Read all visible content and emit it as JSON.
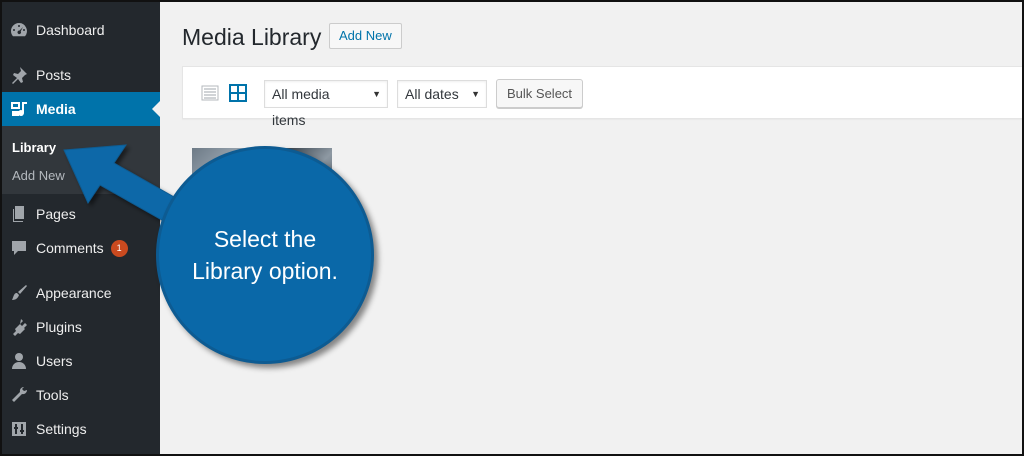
{
  "sidebar": {
    "items": [
      {
        "label": "Dashboard",
        "icon": "dashboard-icon"
      },
      {
        "label": "Posts",
        "icon": "pushpin-icon"
      },
      {
        "label": "Media",
        "icon": "media-icon"
      },
      {
        "label": "Pages",
        "icon": "pages-icon"
      },
      {
        "label": "Comments",
        "icon": "comment-icon",
        "badge": "1"
      },
      {
        "label": "Appearance",
        "icon": "paintbrush-icon"
      },
      {
        "label": "Plugins",
        "icon": "plugin-icon"
      },
      {
        "label": "Users",
        "icon": "user-icon"
      },
      {
        "label": "Tools",
        "icon": "wrench-icon"
      },
      {
        "label": "Settings",
        "icon": "settings-icon"
      }
    ],
    "submenu": [
      "Library",
      "Add New"
    ],
    "active": "Media",
    "active_color": "#0073aa"
  },
  "main": {
    "title": "Media Library",
    "add_new": "Add New",
    "toolbar": {
      "filter_type": "All media items",
      "filter_date": "All dates",
      "bulk_select": "Bulk Select"
    }
  },
  "callout": {
    "text": "Select the Library option.",
    "color": "#0a68a8"
  }
}
